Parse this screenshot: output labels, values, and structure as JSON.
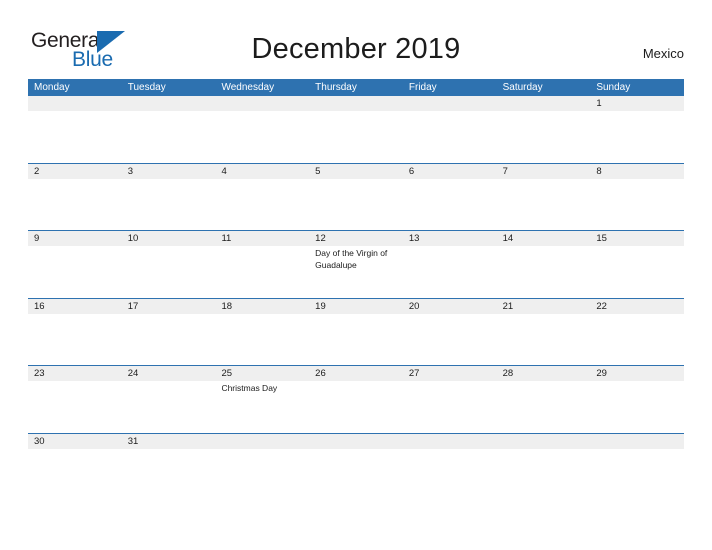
{
  "brand": {
    "name_part1": "General",
    "name_part2": "Blue",
    "triangle_color": "#1a6bb0"
  },
  "header": {
    "title": "December 2019",
    "country": "Mexico"
  },
  "theme": {
    "header_blue": "#2e72b0",
    "band_gray": "#efefef",
    "text_dark": "#1c1c1c",
    "text_white": "#ffffff"
  },
  "calendar": {
    "day_names": [
      "Monday",
      "Tuesday",
      "Wednesday",
      "Thursday",
      "Friday",
      "Saturday",
      "Sunday"
    ],
    "weeks": [
      {
        "days": [
          {
            "num": "",
            "event": ""
          },
          {
            "num": "",
            "event": ""
          },
          {
            "num": "",
            "event": ""
          },
          {
            "num": "",
            "event": ""
          },
          {
            "num": "",
            "event": ""
          },
          {
            "num": "",
            "event": ""
          },
          {
            "num": "1",
            "event": ""
          }
        ]
      },
      {
        "days": [
          {
            "num": "2",
            "event": ""
          },
          {
            "num": "3",
            "event": ""
          },
          {
            "num": "4",
            "event": ""
          },
          {
            "num": "5",
            "event": ""
          },
          {
            "num": "6",
            "event": ""
          },
          {
            "num": "7",
            "event": ""
          },
          {
            "num": "8",
            "event": ""
          }
        ]
      },
      {
        "days": [
          {
            "num": "9",
            "event": ""
          },
          {
            "num": "10",
            "event": ""
          },
          {
            "num": "11",
            "event": ""
          },
          {
            "num": "12",
            "event": "Day of the Virgin of Guadalupe"
          },
          {
            "num": "13",
            "event": ""
          },
          {
            "num": "14",
            "event": ""
          },
          {
            "num": "15",
            "event": ""
          }
        ]
      },
      {
        "days": [
          {
            "num": "16",
            "event": ""
          },
          {
            "num": "17",
            "event": ""
          },
          {
            "num": "18",
            "event": ""
          },
          {
            "num": "19",
            "event": ""
          },
          {
            "num": "20",
            "event": ""
          },
          {
            "num": "21",
            "event": ""
          },
          {
            "num": "22",
            "event": ""
          }
        ]
      },
      {
        "days": [
          {
            "num": "23",
            "event": ""
          },
          {
            "num": "24",
            "event": ""
          },
          {
            "num": "25",
            "event": "Christmas Day"
          },
          {
            "num": "26",
            "event": ""
          },
          {
            "num": "27",
            "event": ""
          },
          {
            "num": "28",
            "event": ""
          },
          {
            "num": "29",
            "event": ""
          }
        ]
      },
      {
        "days": [
          {
            "num": "30",
            "event": ""
          },
          {
            "num": "31",
            "event": ""
          },
          {
            "num": "",
            "event": ""
          },
          {
            "num": "",
            "event": ""
          },
          {
            "num": "",
            "event": ""
          },
          {
            "num": "",
            "event": ""
          },
          {
            "num": "",
            "event": ""
          }
        ]
      }
    ]
  }
}
